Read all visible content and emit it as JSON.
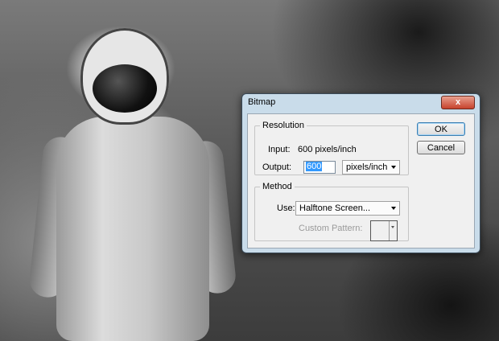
{
  "dialog": {
    "title": "Bitmap",
    "close_label": "x",
    "resolution": {
      "legend": "Resolution",
      "input_label": "Input:",
      "input_value": "600 pixels/inch",
      "output_label": "Output:",
      "output_value": "600",
      "output_unit": "pixels/inch"
    },
    "method": {
      "legend": "Method",
      "use_label": "Use:",
      "use_value": "Halftone Screen...",
      "custom_pattern_label": "Custom Pattern:"
    },
    "buttons": {
      "ok": "OK",
      "cancel": "Cancel"
    }
  }
}
